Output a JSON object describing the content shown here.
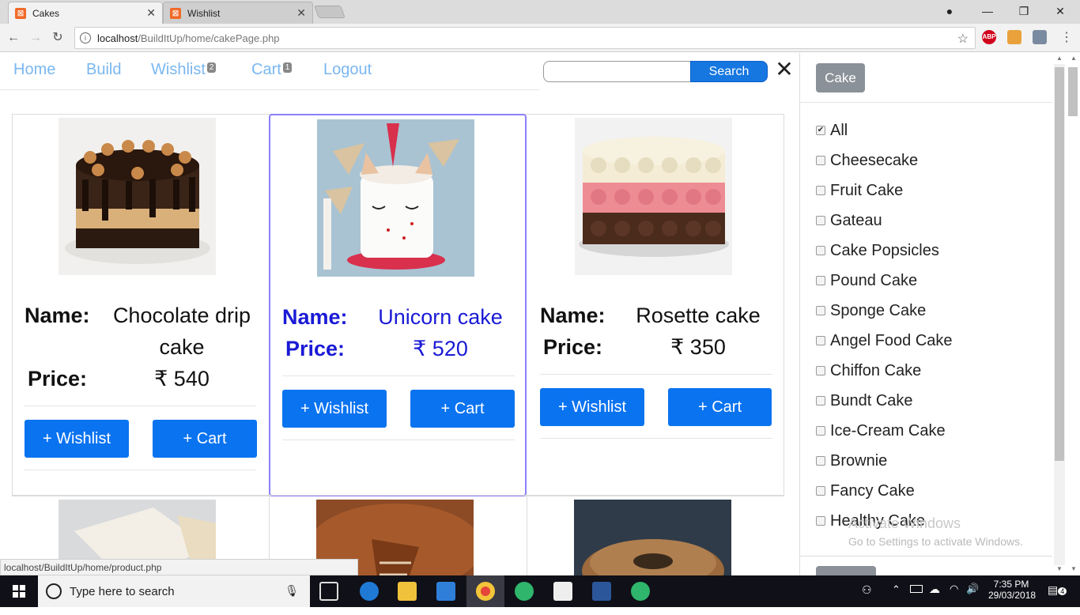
{
  "browser": {
    "tabs": [
      {
        "title": "Cakes",
        "active": true
      },
      {
        "title": "Wishlist",
        "active": false
      }
    ],
    "url_host": "localhost",
    "url_path": "/BuildItUp/home/cakePage.php",
    "status_url": "localhost/BuildItUp/home/product.php",
    "extensions": [
      "ABP"
    ]
  },
  "nav": {
    "home": "Home",
    "build": "Build",
    "wishlist": "Wishlist",
    "wishlist_count": "2",
    "cart": "Cart",
    "cart_count": "1",
    "logout": "Logout",
    "search_button": "Search",
    "close_icon": "✕"
  },
  "labels": {
    "name": "Name:",
    "price": "Price:",
    "wishlist_btn": "+ Wishlist",
    "cart_btn": "+ Cart"
  },
  "products": [
    {
      "name_line1": "Chocolate drip",
      "name_line2": "cake",
      "price": "₹ 540",
      "selected": false
    },
    {
      "name_line1": "Unicorn cake",
      "name_line2": "",
      "price": "₹ 520",
      "selected": true
    },
    {
      "name_line1": "Rosette cake",
      "name_line2": "",
      "price": "₹ 350",
      "selected": false
    }
  ],
  "sidebar": {
    "category_button": "Cake",
    "filters": [
      {
        "label": "All",
        "checked": true
      },
      {
        "label": "Cheesecake",
        "checked": false
      },
      {
        "label": "Fruit Cake",
        "checked": false
      },
      {
        "label": "Gateau",
        "checked": false
      },
      {
        "label": "Cake Popsicles",
        "checked": false
      },
      {
        "label": "Pound Cake",
        "checked": false
      },
      {
        "label": "Sponge Cake",
        "checked": false
      },
      {
        "label": "Angel Food Cake",
        "checked": false
      },
      {
        "label": "Chiffon Cake",
        "checked": false
      },
      {
        "label": "Bundt Cake",
        "checked": false
      },
      {
        "label": "Ice-Cream Cake",
        "checked": false
      },
      {
        "label": "Brownie",
        "checked": false
      },
      {
        "label": "Fancy Cake",
        "checked": false
      },
      {
        "label": "Healthy Cake",
        "checked": false
      }
    ]
  },
  "watermark": {
    "line1": "Activate Windows",
    "line2": "Go to Settings to activate Windows."
  },
  "taskbar": {
    "search_placeholder": "Type here to search",
    "time": "7:35 PM",
    "date": "29/03/2018",
    "notification_count": "4"
  },
  "colors": {
    "primary_button": "#0a73f0",
    "nav_link": "#7ab7f0",
    "selected_text": "#1a1ad6",
    "selected_border": "#8b80f9"
  }
}
